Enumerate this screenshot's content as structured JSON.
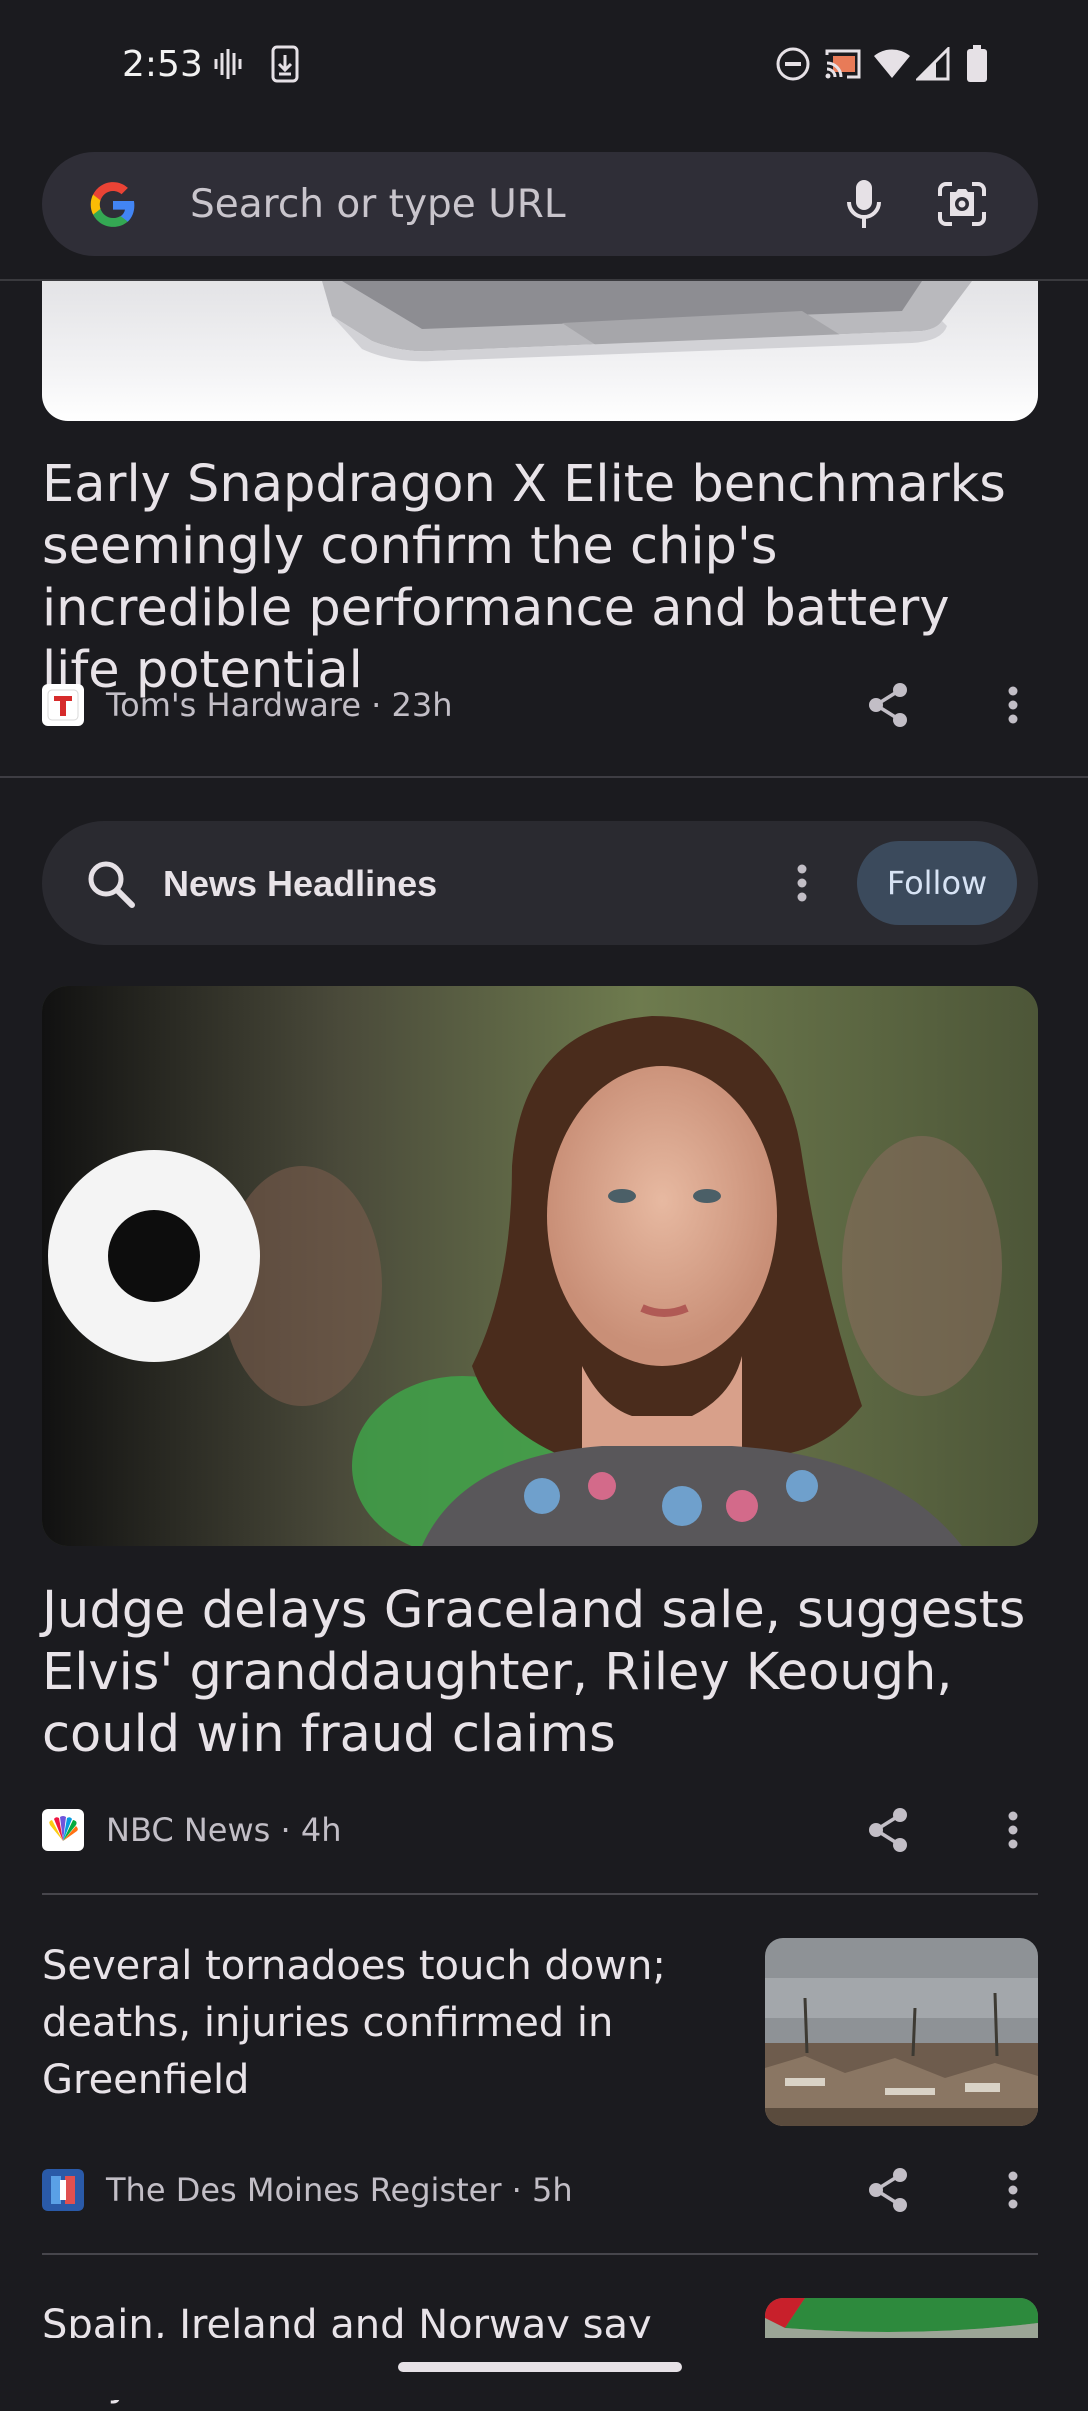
{
  "status": {
    "time": "2:53"
  },
  "search": {
    "placeholder": "Search or type URL"
  },
  "articles": [
    {
      "headline": "Early Snapdragon X Elite benchmarks seemingly confirm the chip's incredible performance and battery life potential",
      "source": "Tom's Hardware · 23h"
    },
    {
      "headline": "Judge delays Graceland sale, suggests Elvis' granddaughter, Riley Keough, could win fraud claims",
      "source": "NBC News · 4h"
    },
    {
      "headline": "Several tornadoes touch down; deaths, injuries confirmed in Greenfield",
      "source": "The Des Moines Register · 5h"
    },
    {
      "headline": "Spain, Ireland and Norway say they"
    }
  ],
  "topic": {
    "label": "News Headlines",
    "follow_label": "Follow"
  },
  "colors": {
    "background": "#1b1b1f",
    "follow_button": "#3b4a5c",
    "search_bar": "#2f2e37"
  }
}
